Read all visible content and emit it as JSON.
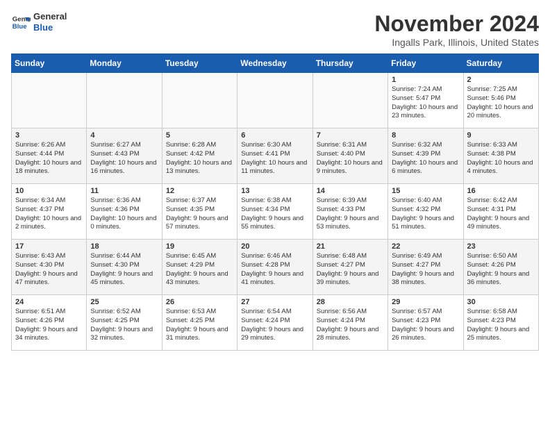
{
  "logo": {
    "line1": "General",
    "line2": "Blue"
  },
  "title": "November 2024",
  "subtitle": "Ingalls Park, Illinois, United States",
  "days_header": [
    "Sunday",
    "Monday",
    "Tuesday",
    "Wednesday",
    "Thursday",
    "Friday",
    "Saturday"
  ],
  "weeks": [
    [
      {
        "day": "",
        "info": ""
      },
      {
        "day": "",
        "info": ""
      },
      {
        "day": "",
        "info": ""
      },
      {
        "day": "",
        "info": ""
      },
      {
        "day": "",
        "info": ""
      },
      {
        "day": "1",
        "info": "Sunrise: 7:24 AM\nSunset: 5:47 PM\nDaylight: 10 hours and 23 minutes."
      },
      {
        "day": "2",
        "info": "Sunrise: 7:25 AM\nSunset: 5:46 PM\nDaylight: 10 hours and 20 minutes."
      }
    ],
    [
      {
        "day": "3",
        "info": "Sunrise: 6:26 AM\nSunset: 4:44 PM\nDaylight: 10 hours and 18 minutes."
      },
      {
        "day": "4",
        "info": "Sunrise: 6:27 AM\nSunset: 4:43 PM\nDaylight: 10 hours and 16 minutes."
      },
      {
        "day": "5",
        "info": "Sunrise: 6:28 AM\nSunset: 4:42 PM\nDaylight: 10 hours and 13 minutes."
      },
      {
        "day": "6",
        "info": "Sunrise: 6:30 AM\nSunset: 4:41 PM\nDaylight: 10 hours and 11 minutes."
      },
      {
        "day": "7",
        "info": "Sunrise: 6:31 AM\nSunset: 4:40 PM\nDaylight: 10 hours and 9 minutes."
      },
      {
        "day": "8",
        "info": "Sunrise: 6:32 AM\nSunset: 4:39 PM\nDaylight: 10 hours and 6 minutes."
      },
      {
        "day": "9",
        "info": "Sunrise: 6:33 AM\nSunset: 4:38 PM\nDaylight: 10 hours and 4 minutes."
      }
    ],
    [
      {
        "day": "10",
        "info": "Sunrise: 6:34 AM\nSunset: 4:37 PM\nDaylight: 10 hours and 2 minutes."
      },
      {
        "day": "11",
        "info": "Sunrise: 6:36 AM\nSunset: 4:36 PM\nDaylight: 10 hours and 0 minutes."
      },
      {
        "day": "12",
        "info": "Sunrise: 6:37 AM\nSunset: 4:35 PM\nDaylight: 9 hours and 57 minutes."
      },
      {
        "day": "13",
        "info": "Sunrise: 6:38 AM\nSunset: 4:34 PM\nDaylight: 9 hours and 55 minutes."
      },
      {
        "day": "14",
        "info": "Sunrise: 6:39 AM\nSunset: 4:33 PM\nDaylight: 9 hours and 53 minutes."
      },
      {
        "day": "15",
        "info": "Sunrise: 6:40 AM\nSunset: 4:32 PM\nDaylight: 9 hours and 51 minutes."
      },
      {
        "day": "16",
        "info": "Sunrise: 6:42 AM\nSunset: 4:31 PM\nDaylight: 9 hours and 49 minutes."
      }
    ],
    [
      {
        "day": "17",
        "info": "Sunrise: 6:43 AM\nSunset: 4:30 PM\nDaylight: 9 hours and 47 minutes."
      },
      {
        "day": "18",
        "info": "Sunrise: 6:44 AM\nSunset: 4:30 PM\nDaylight: 9 hours and 45 minutes."
      },
      {
        "day": "19",
        "info": "Sunrise: 6:45 AM\nSunset: 4:29 PM\nDaylight: 9 hours and 43 minutes."
      },
      {
        "day": "20",
        "info": "Sunrise: 6:46 AM\nSunset: 4:28 PM\nDaylight: 9 hours and 41 minutes."
      },
      {
        "day": "21",
        "info": "Sunrise: 6:48 AM\nSunset: 4:27 PM\nDaylight: 9 hours and 39 minutes."
      },
      {
        "day": "22",
        "info": "Sunrise: 6:49 AM\nSunset: 4:27 PM\nDaylight: 9 hours and 38 minutes."
      },
      {
        "day": "23",
        "info": "Sunrise: 6:50 AM\nSunset: 4:26 PM\nDaylight: 9 hours and 36 minutes."
      }
    ],
    [
      {
        "day": "24",
        "info": "Sunrise: 6:51 AM\nSunset: 4:26 PM\nDaylight: 9 hours and 34 minutes."
      },
      {
        "day": "25",
        "info": "Sunrise: 6:52 AM\nSunset: 4:25 PM\nDaylight: 9 hours and 32 minutes."
      },
      {
        "day": "26",
        "info": "Sunrise: 6:53 AM\nSunset: 4:25 PM\nDaylight: 9 hours and 31 minutes."
      },
      {
        "day": "27",
        "info": "Sunrise: 6:54 AM\nSunset: 4:24 PM\nDaylight: 9 hours and 29 minutes."
      },
      {
        "day": "28",
        "info": "Sunrise: 6:56 AM\nSunset: 4:24 PM\nDaylight: 9 hours and 28 minutes."
      },
      {
        "day": "29",
        "info": "Sunrise: 6:57 AM\nSunset: 4:23 PM\nDaylight: 9 hours and 26 minutes."
      },
      {
        "day": "30",
        "info": "Sunrise: 6:58 AM\nSunset: 4:23 PM\nDaylight: 9 hours and 25 minutes."
      }
    ]
  ]
}
